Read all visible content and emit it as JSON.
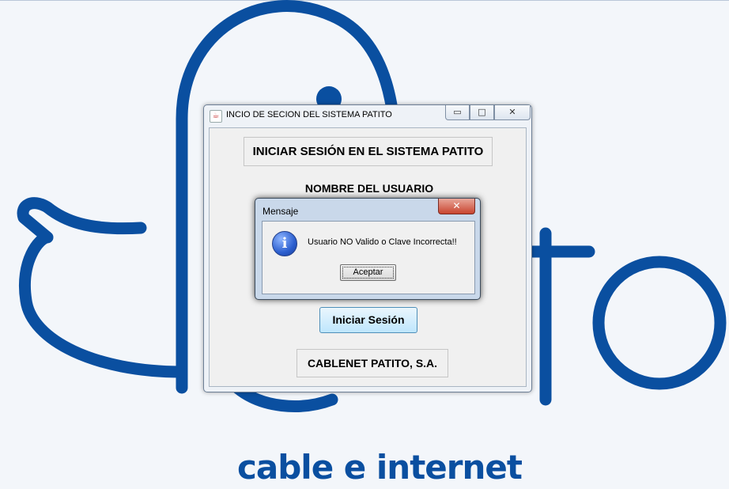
{
  "background": {
    "tagline": "cable e internet",
    "brand_color": "#0a4fa0"
  },
  "login_window": {
    "title": "INCIO DE SECION DEL SISTEMA PATITO",
    "heading": "INICIAR SESIÓN EN EL SISTEMA PATITO",
    "username_label": "NOMBRE DEL USUARIO",
    "login_button": "Iniciar Sesión",
    "company": "CABLENET PATITO, S.A.",
    "controls": {
      "minimize": "▭",
      "maximize": "□",
      "close": "✕"
    }
  },
  "message_dialog": {
    "title": "Mensaje",
    "message": "Usuario NO Valido o Clave Incorrecta!!",
    "ok_button": "Aceptar",
    "close": "✕",
    "icon": "info-icon"
  }
}
